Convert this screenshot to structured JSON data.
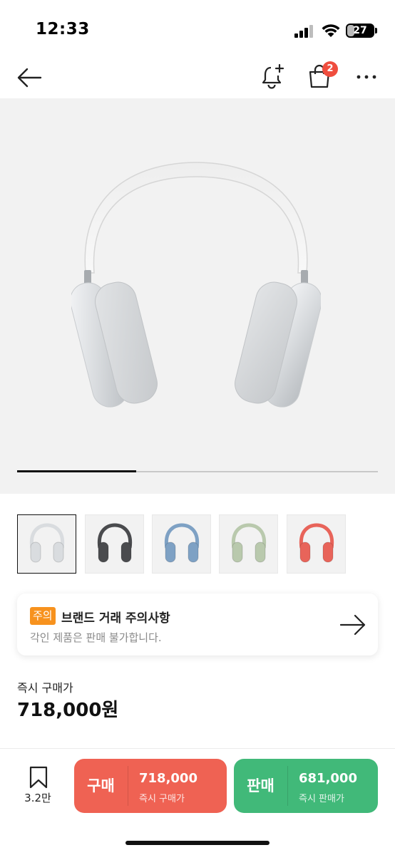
{
  "status_bar": {
    "time": "12:33",
    "battery": "27",
    "battery_level": 0.27
  },
  "nav": {
    "cart_badge": "2"
  },
  "hero": {
    "progress_fraction": 0.33
  },
  "thumbnails": [
    {
      "color": "silver",
      "accent": "#d9dcdf"
    },
    {
      "color": "space-gray",
      "accent": "#4a4b4e"
    },
    {
      "color": "sky-blue",
      "accent": "#7ea1c4"
    },
    {
      "color": "green",
      "accent": "#b9c9ad"
    },
    {
      "color": "pink",
      "accent": "#e8645a"
    }
  ],
  "notice": {
    "badge": "주의",
    "title": "브랜드 거래 주의사항",
    "description": "각인 제품은 판매 불가합니다."
  },
  "price": {
    "label": "즉시 구매가",
    "value": "718,000원"
  },
  "bottom_bar": {
    "bookmark_count": "3.2만",
    "buy": {
      "label": "구매",
      "price": "718,000",
      "sub": "즉시 구매가"
    },
    "sell": {
      "label": "판매",
      "price": "681,000",
      "sub": "즉시 판매가"
    }
  },
  "colors": {
    "buy": "#ef6253",
    "sell": "#41b979",
    "badge": "#f7921e",
    "cart_badge": "#ef4d3e"
  }
}
